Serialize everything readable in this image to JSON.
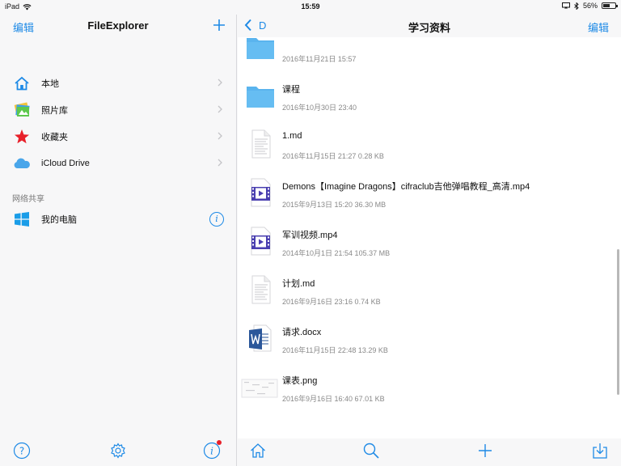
{
  "status": {
    "device": "iPad",
    "time": "15:59",
    "battery": "56%",
    "battery_level": 0.56
  },
  "left": {
    "edit_label": "编辑",
    "title": "FileExplorer",
    "items": [
      {
        "label": "本地",
        "icon": "house-icon"
      },
      {
        "label": "照片库",
        "icon": "photos-icon"
      },
      {
        "label": "收藏夹",
        "icon": "star-icon"
      },
      {
        "label": "iCloud Drive",
        "icon": "cloud-icon"
      }
    ],
    "network_section": "网络共享",
    "network_item": {
      "label": "我的电脑",
      "icon": "windows-icon",
      "info": "i"
    },
    "toolbar": {
      "help": "?",
      "info": "i"
    }
  },
  "right": {
    "back_label": "D",
    "title": "学习资料",
    "edit_label": "编辑",
    "files": [
      {
        "name": "",
        "meta": "2016年11月21日 15:57",
        "type": "folder"
      },
      {
        "name": "课程",
        "meta": "2016年10月30日 23:40",
        "type": "folder"
      },
      {
        "name": "1.md",
        "meta": "2016年11月15日 21:27   0.28 KB",
        "type": "text"
      },
      {
        "name": "Demons【Imagine Dragons】cifraclub吉他弹唱教程_高清.mp4",
        "meta": "2015年9月13日 15:20   36.30 MB",
        "type": "video"
      },
      {
        "name": "军训视频.mp4",
        "meta": "2014年10月1日 21:54   105.37 MB",
        "type": "video"
      },
      {
        "name": "计划.md",
        "meta": "2016年9月16日 23:16   0.74 KB",
        "type": "text"
      },
      {
        "name": "请求.docx",
        "meta": "2016年11月15日 22:48   13.29 KB",
        "type": "word"
      },
      {
        "name": "课表.png",
        "meta": "2016年9月16日 16:40   67.01 KB",
        "type": "image"
      }
    ]
  },
  "colors": {
    "accent": "#1e8ae6",
    "folder": "#5ab4ee",
    "video": "#4a3fb0",
    "word": "#2b579a",
    "badge": "#e8202a"
  }
}
